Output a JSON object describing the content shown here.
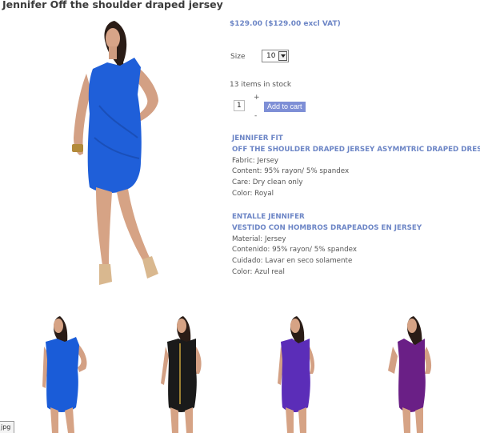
{
  "product": {
    "title": "Jennifer Off the shoulder draped jersey",
    "price": "$129.00 ($129.00 excl VAT)",
    "size_label": "Size",
    "size_value": "10",
    "stock": "13 items in stock",
    "quantity": "1",
    "plus": "+",
    "minus": "-",
    "add_to_cart": "Add to cart"
  },
  "description_en": {
    "heading1": "JENNIFER FIT",
    "heading2": "OFF THE SHOULDER DRAPED JERSEY ASYMMTRIC DRAPED DRESS",
    "lines": [
      "Fabric: Jersey",
      "Content: 95% rayon/ 5% spandex",
      "Care: Dry clean only",
      "Color: Royal"
    ]
  },
  "description_es": {
    "heading1": "ENTALLE JENNIFER",
    "heading2": "VESTIDO CON  HOMBROS DRAPEADOS EN JERSEY",
    "lines": [
      "Material: Jersey",
      "Contenido: 95% rayon/ 5% spandex",
      "Cuidado: Lavar en seco solamente",
      "Color: Azul real"
    ]
  },
  "thumbnails": [
    {
      "dress_color": "#1a5cd8"
    },
    {
      "dress_color": "#1a1a1a"
    },
    {
      "dress_color": "#5b2db8"
    },
    {
      "dress_color": "#6a1f86"
    }
  ],
  "image_label": "jpg",
  "colors": {
    "accent": "#6d86c6",
    "button": "#7e8fd6",
    "main_dress": "#1f5fd9"
  }
}
